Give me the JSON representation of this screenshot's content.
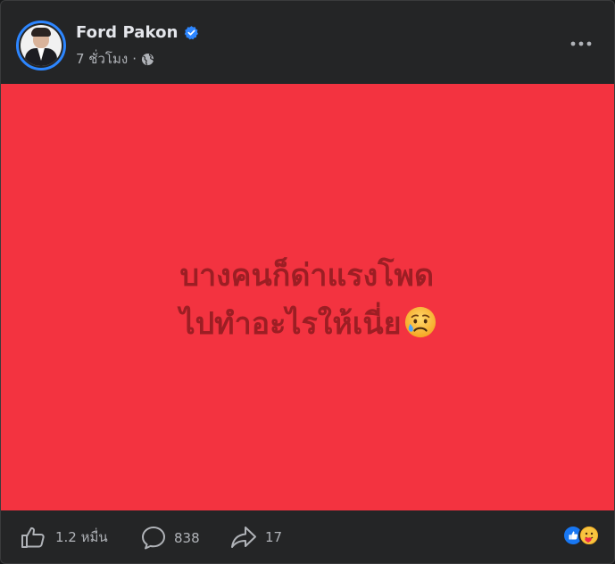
{
  "post": {
    "author": "Ford Pakon",
    "time": "7 ชั่วโมง",
    "separator": "·",
    "verified_icon": "verified-badge-icon",
    "privacy_icon": "globe-icon",
    "text_line1": "บางคนก็ด่าแรงโพด",
    "text_line2": "ไปทำอะไรให้เนี่ย",
    "emoji": "sad-but-relieved-face-emoji",
    "background_color": "#f33340",
    "text_color": "#9c1e24"
  },
  "actions": {
    "likes": "1.2 หมื่น",
    "comments": "838",
    "shares": "17"
  },
  "reactions": [
    "like-reaction-icon",
    "care-reaction-icon"
  ],
  "colors": {
    "card_bg": "#242526",
    "accent": "#2d86ff",
    "secondary_text": "#b0b3b8"
  }
}
